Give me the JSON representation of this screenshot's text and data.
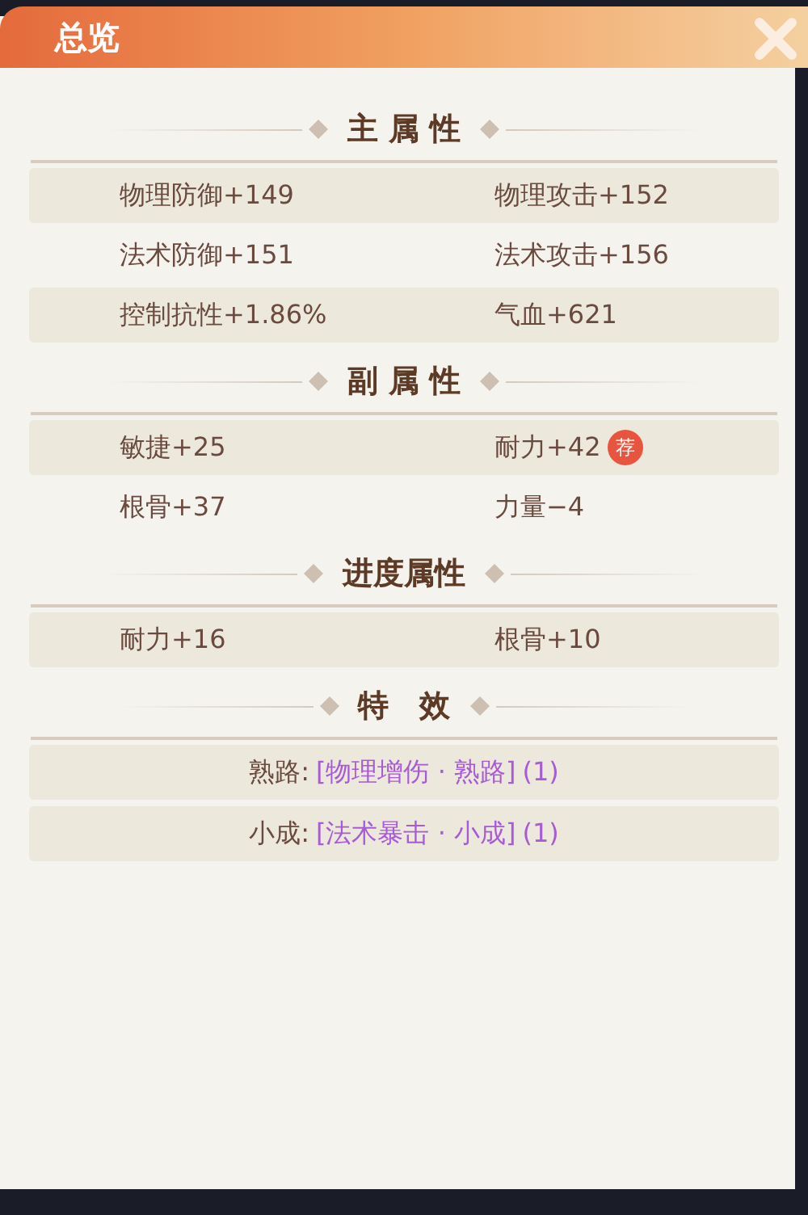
{
  "window": {
    "title": "总览"
  },
  "sections": [
    {
      "heading": "主 属 性",
      "rows": [
        {
          "cells": [
            {
              "text": "物理防御+149"
            },
            {
              "text": "物理攻击+152"
            }
          ]
        },
        {
          "cells": [
            {
              "text": "法术防御+151"
            },
            {
              "text": "法术攻击+156"
            }
          ]
        },
        {
          "cells": [
            {
              "text": "控制抗性+1.86%"
            },
            {
              "text": "气血+621"
            }
          ]
        }
      ]
    },
    {
      "heading": "副 属 性",
      "rows": [
        {
          "cells": [
            {
              "text": "敏捷+25"
            },
            {
              "text": "耐力+42",
              "badge": "荐"
            }
          ]
        },
        {
          "cells": [
            {
              "text": "根骨+37"
            },
            {
              "text": "力量−4"
            }
          ]
        }
      ]
    },
    {
      "heading": "进度属性",
      "rows": [
        {
          "cells": [
            {
              "text": "耐力+16"
            },
            {
              "text": "根骨+10"
            }
          ]
        }
      ]
    }
  ],
  "effects": {
    "heading": "特　效",
    "items": [
      {
        "label": "熟路:",
        "effect": "[物理增伤 · 熟路]",
        "count": "(1)"
      },
      {
        "label": "小成:",
        "effect": "[法术暴击 · 小成]",
        "count": "(1)"
      }
    ]
  }
}
